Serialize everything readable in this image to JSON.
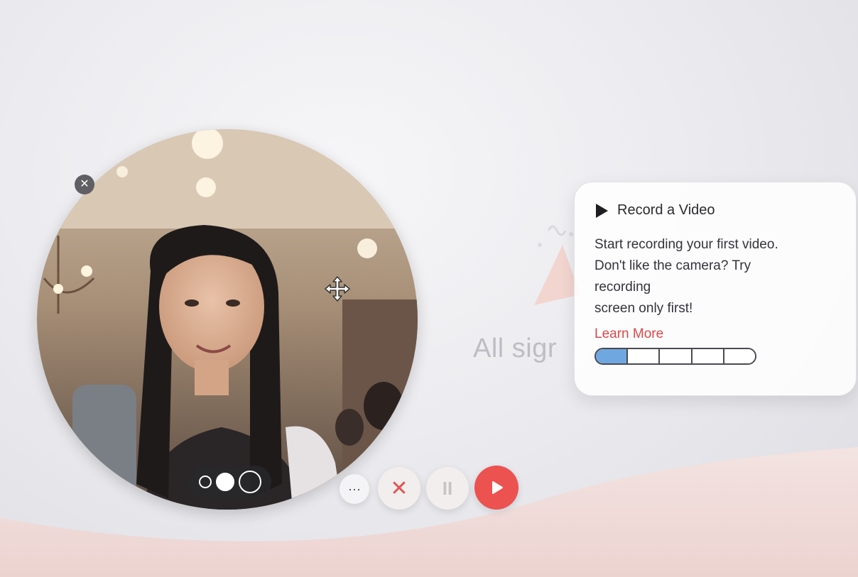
{
  "background": {
    "partial_title": "All sigr"
  },
  "camera_bubble": {
    "close_icon": "close-icon",
    "move_icon": "move-icon",
    "size_options": [
      "small",
      "medium",
      "large"
    ],
    "selected_size": "medium"
  },
  "controls": {
    "more_label": "···",
    "cancel_label": "✕",
    "pause_label": "II",
    "record_icon": "play-icon"
  },
  "tooltip": {
    "title": "Record a Video",
    "body_line1": "Start recording your first video.",
    "body_line2": "Don't like the camera? Try",
    "body_line3": "recording",
    "body_line4": "screen only first!",
    "link": "Learn More",
    "steps_total": 5,
    "steps_done": 1
  },
  "colors": {
    "accent_red": "#ec5250",
    "link_red": "#d9484a",
    "step_blue": "#6fa7e0"
  }
}
